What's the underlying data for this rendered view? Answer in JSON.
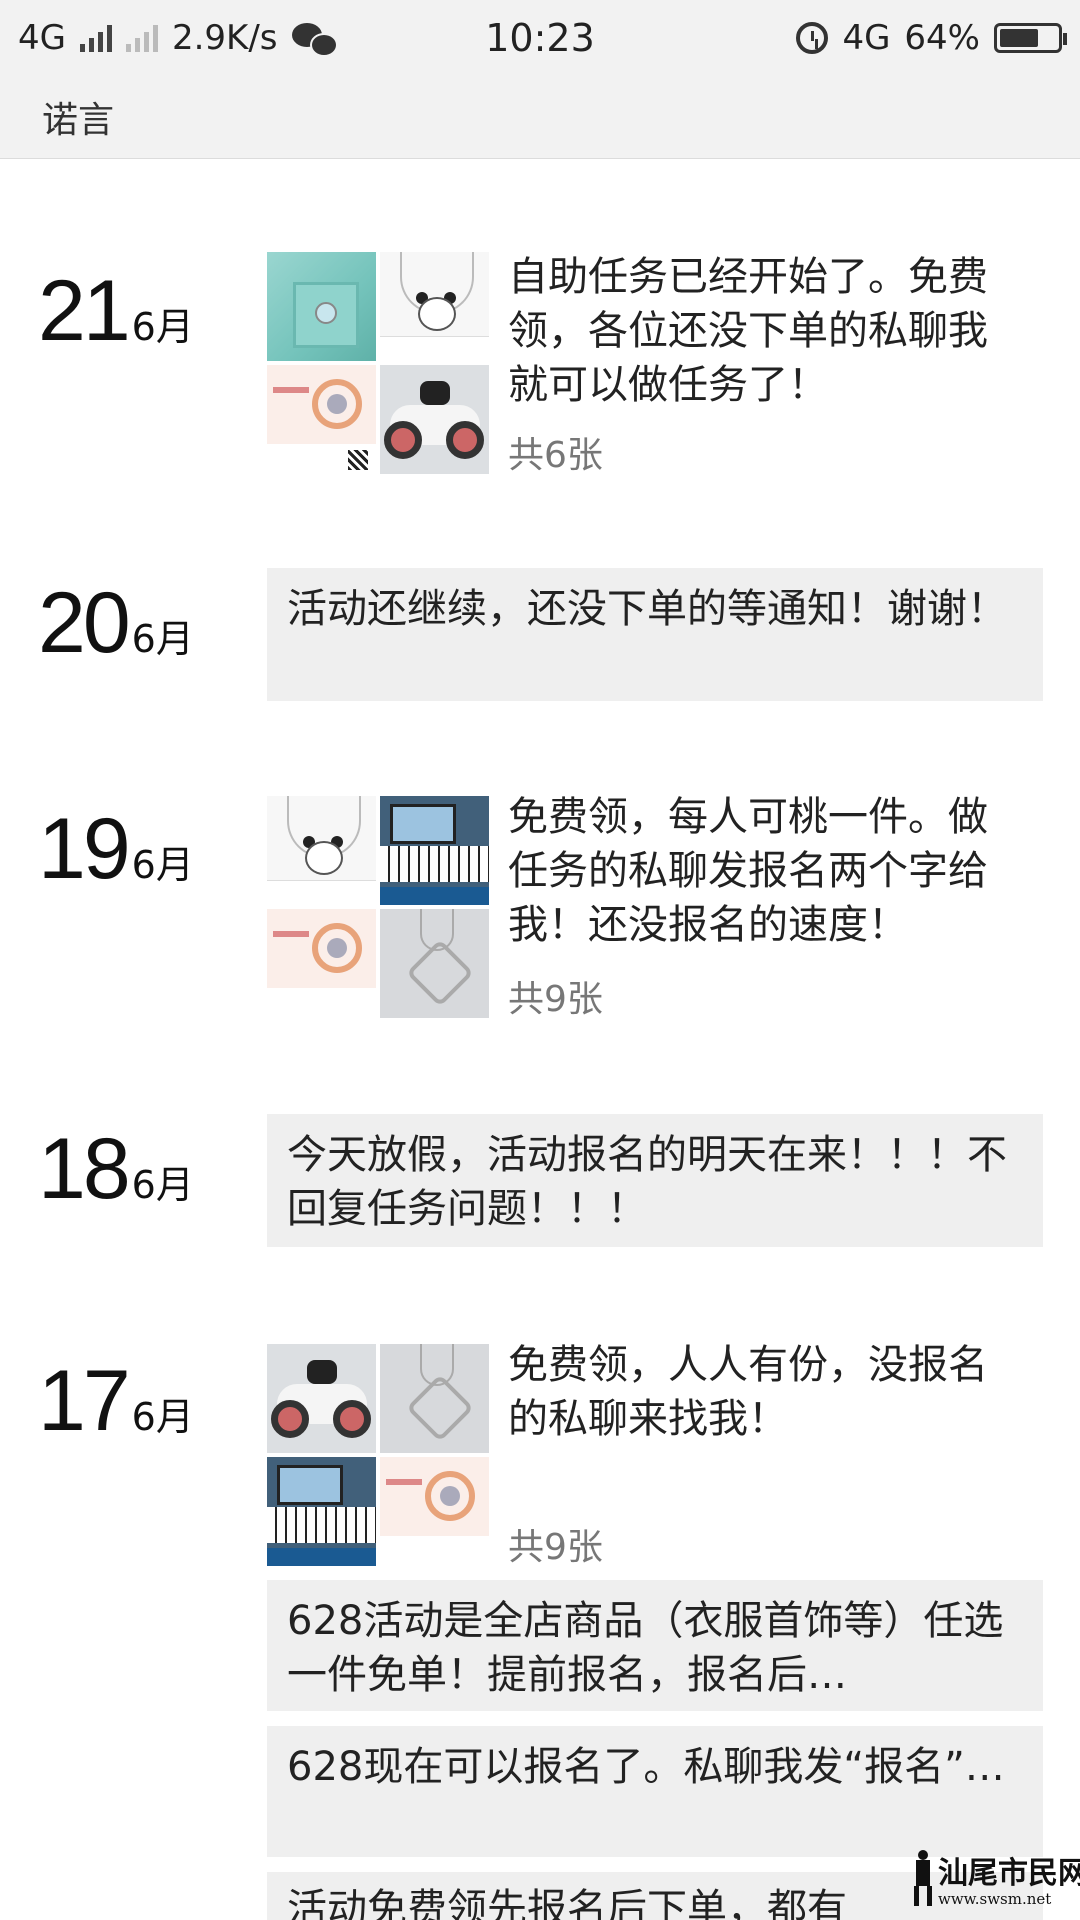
{
  "status_bar": {
    "network_left": "4G",
    "speed": "2.9K/s",
    "time": "10:23",
    "network_right": "4G",
    "battery": "64%"
  },
  "header": {
    "title": "诺言"
  },
  "posts": [
    {
      "day": "21",
      "month": "6月",
      "text": "自助任务已经开始了。免费领，各位还没下单的私聊我就可以做任务了！",
      "count": "共6张"
    },
    {
      "day": "20",
      "month": "6月",
      "text": "活动还继续，还没下单的等通知！谢谢！"
    },
    {
      "day": "19",
      "month": "6月",
      "text": "免费领，每人可桃一件。做任务的私聊发报名两个字给我！还没报名的速度！",
      "count": "共9张"
    },
    {
      "day": "18",
      "month": "6月",
      "text": "今天放假，活动报名的明天在来！！！不回复任务问题！！！"
    },
    {
      "day": "17",
      "month": "6月",
      "text": "免费领，人人有份，没报名的私聊来找我！",
      "count": "共9张"
    }
  ],
  "extra_posts": [
    {
      "text": "628活动是全店商品（衣服首饰等）任选一件免单！提前报名，报名后…"
    },
    {
      "text": "628现在可以报名了。私聊我发“报名”…"
    },
    {
      "text": "活动免费领先报名后下单，都有"
    }
  ],
  "watermark": {
    "title": "汕尾市民网",
    "url": "www.swsm.net"
  }
}
